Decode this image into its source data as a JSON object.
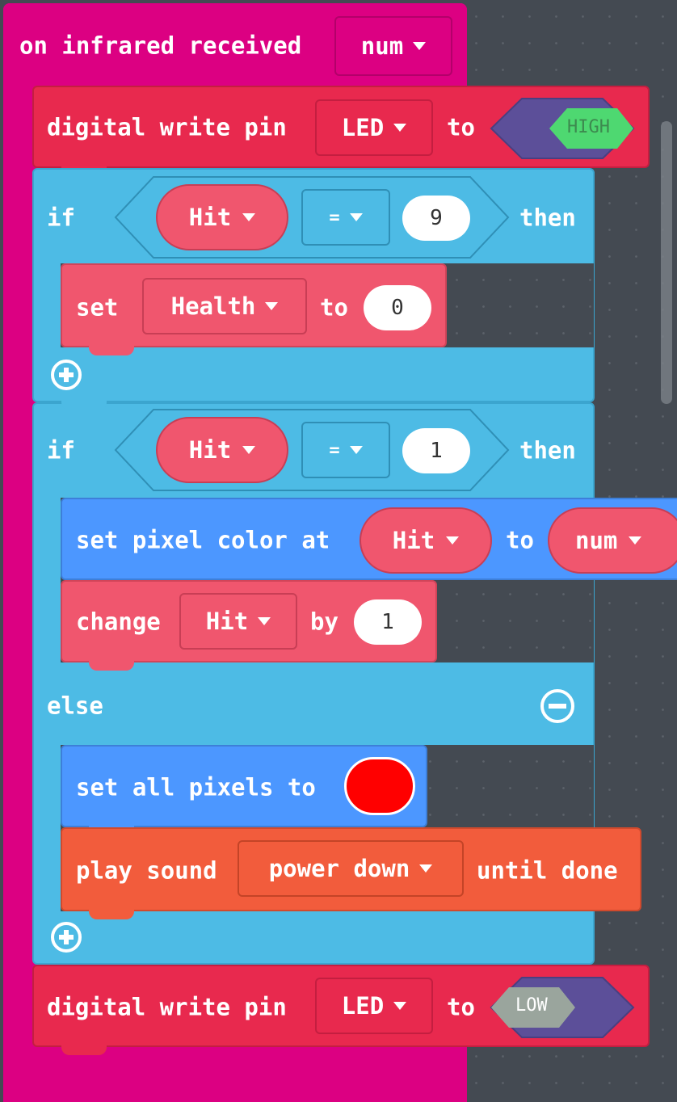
{
  "event": {
    "label": "on infrared received",
    "param": "num"
  },
  "digital_write_1": {
    "label": "digital write pin",
    "pin": "LED",
    "to_label": "to",
    "value": "HIGH"
  },
  "if_1": {
    "if_label": "if",
    "left": "Hit",
    "op": "=",
    "right": "9",
    "then_label": "then",
    "set_label": "set",
    "set_var": "Health",
    "set_to_label": "to",
    "set_value": "0"
  },
  "if_2": {
    "if_label": "if",
    "left": "Hit",
    "op": "=",
    "right": "1",
    "then_label": "then",
    "pixel_label": "set pixel color at",
    "pixel_index": "Hit",
    "pixel_to_label": "to",
    "pixel_value": "num",
    "change_label": "change",
    "change_var": "Hit",
    "by_label": "by",
    "change_value": "1",
    "else_label": "else",
    "all_pixels_label": "set all pixels to",
    "all_pixels_color": "#ff0000",
    "play_label": "play sound",
    "sound": "power down",
    "until_label": "until done"
  },
  "digital_write_2": {
    "label": "digital write pin",
    "pin": "LED",
    "to_label": "to",
    "value": "LOW"
  },
  "colors": {
    "event": "#dc0082",
    "pins": "#e8294e",
    "logic": "#4dbbe5",
    "variables": "#f0566e",
    "light": "#4c97ff",
    "music": "#f25c3c",
    "bool_shadow": "#5c4f99",
    "high": "#4ed871",
    "low": "#9aa59d",
    "workspace": "#444a52"
  },
  "icons": {
    "add": "plus-circle-icon",
    "remove": "minus-circle-icon",
    "dropdown": "caret-down-icon"
  }
}
